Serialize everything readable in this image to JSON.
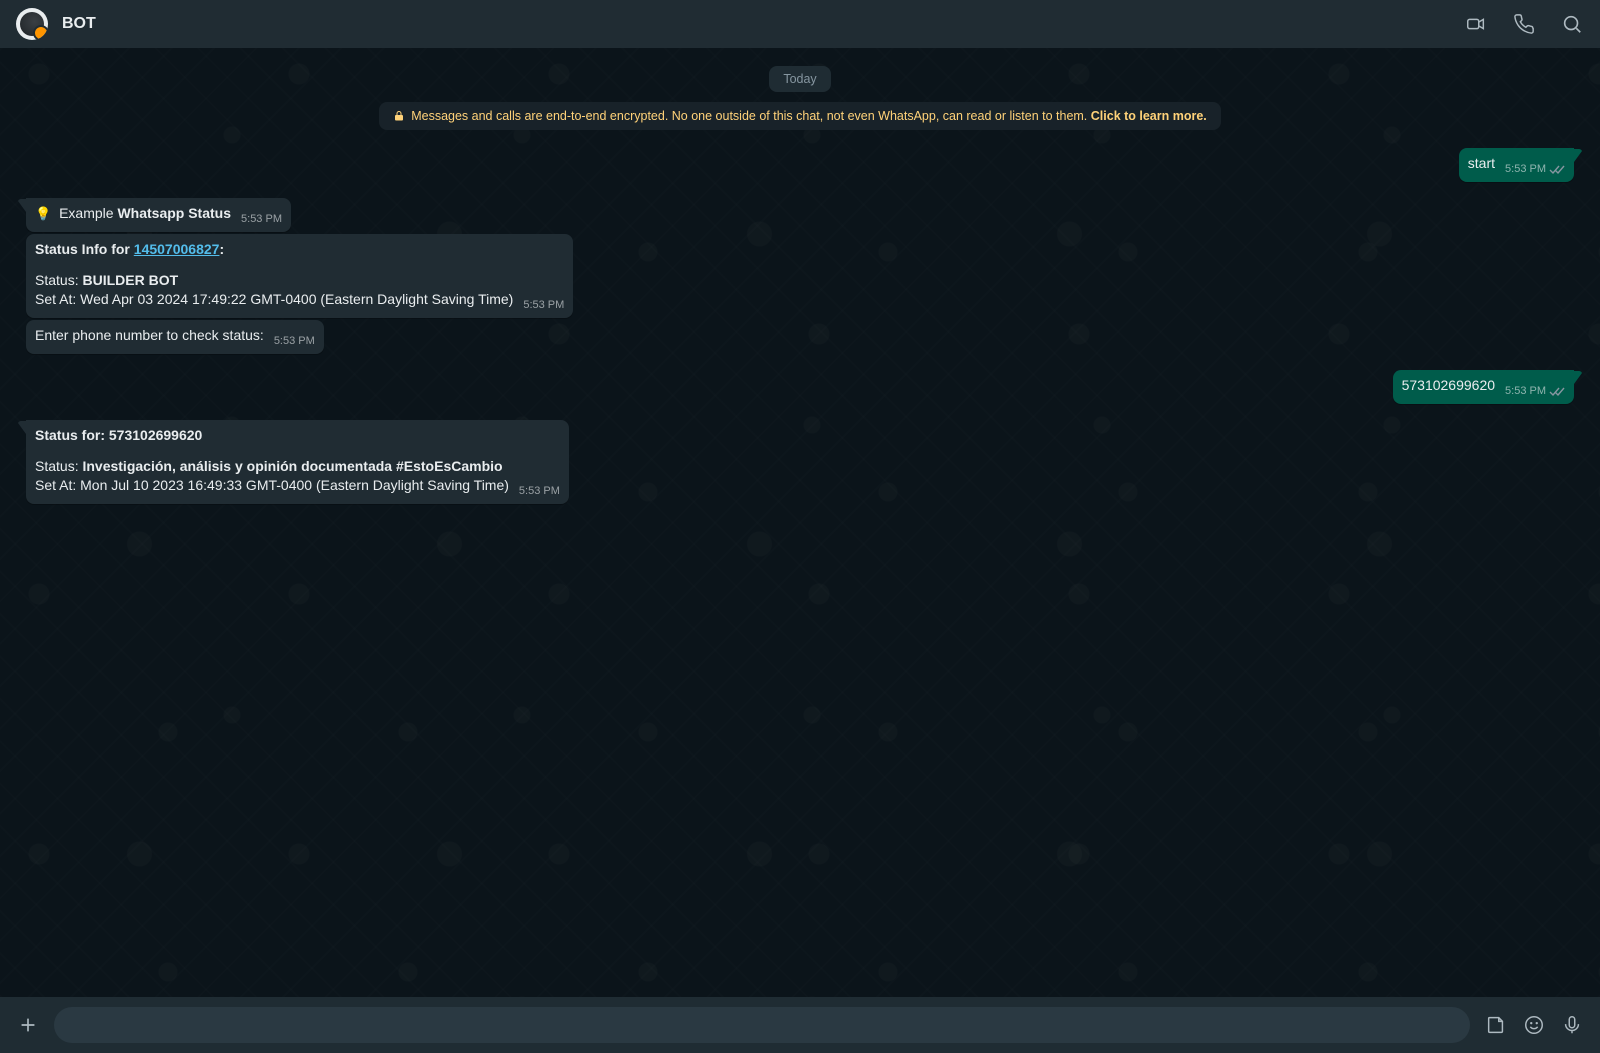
{
  "header": {
    "chat_name": "BOT"
  },
  "chat": {
    "day_label": "Today",
    "encryption_notice": {
      "text": "Messages and calls are end-to-end encrypted. No one outside of this chat, not even WhatsApp, can read or listen to them. ",
      "cta": "Click to learn more."
    }
  },
  "messages": {
    "m1": {
      "body": "start",
      "time": "5:53 PM"
    },
    "m2": {
      "prefix": "Example ",
      "bold": "Whatsapp Status",
      "time": "5:53 PM"
    },
    "m3": {
      "line1_prefix": "Status Info for ",
      "line1_link": "14507006827",
      "line1_suffix": ":",
      "line2_label": "Status: ",
      "line2_value": "BUILDER BOT",
      "line3": "Set At: Wed Apr 03 2024 17:49:22 GMT-0400 (Eastern Daylight Saving Time)",
      "time": "5:53 PM"
    },
    "m4": {
      "body": "Enter phone number to check status:",
      "time": "5:53 PM"
    },
    "m5": {
      "body": "573102699620",
      "time": "5:53 PM"
    },
    "m6": {
      "line1": "Status for: 573102699620",
      "line2_label": "Status: ",
      "line2_value": "Investigación, análisis y opinión documentada #EstoEsCambio",
      "line3": "Set At: Mon Jul 10 2023 16:49:33 GMT-0400 (Eastern Daylight Saving Time)",
      "time": "5:53 PM"
    }
  }
}
